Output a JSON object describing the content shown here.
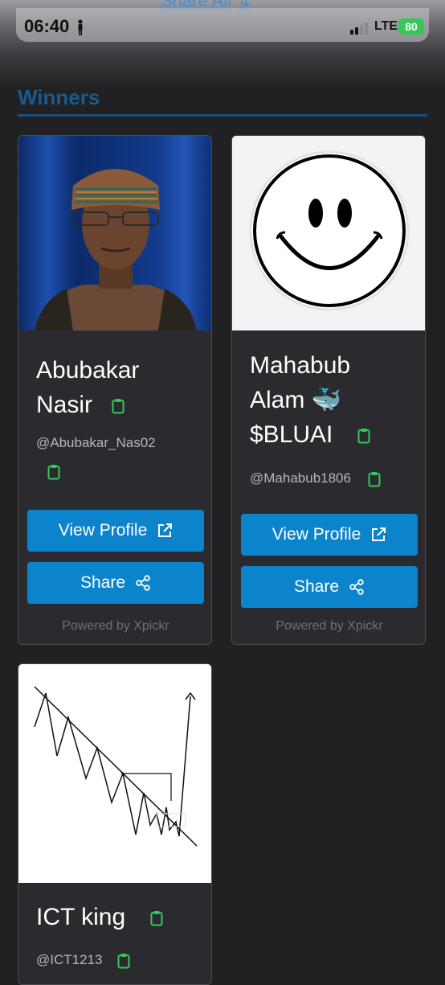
{
  "status_bar": {
    "time": "06:40",
    "network": "LTE",
    "battery": "80"
  },
  "top_link": {
    "label": "Share All"
  },
  "section": {
    "title": "Winners"
  },
  "cards": [
    {
      "name_line1": "Abubakar",
      "name_line2": "Nasir",
      "handle": "@Abubakar_Nas02",
      "view_label": "View Profile",
      "share_label": "Share",
      "powered": "Powered by Xpickr"
    },
    {
      "name_line1": "Mahabub",
      "name_line2": "Alam 🐳",
      "name_line3": "$BLUAI",
      "handle": "@Mahabub1806",
      "view_label": "View Profile",
      "share_label": "Share",
      "powered": "Powered by Xpickr"
    },
    {
      "name_line1": "ICT king",
      "handle": "@ICT1213"
    }
  ],
  "colors": {
    "background": "#212124",
    "card": "#2b2b2f",
    "button": "#0b84cc",
    "section_title": "#1b5a8e",
    "clipboard_icon": "#34c759"
  },
  "icons": [
    "person-icon",
    "signal-icon",
    "battery-icon",
    "clipboard-icon",
    "external-link-icon",
    "share-icon",
    "swap-icon"
  ]
}
